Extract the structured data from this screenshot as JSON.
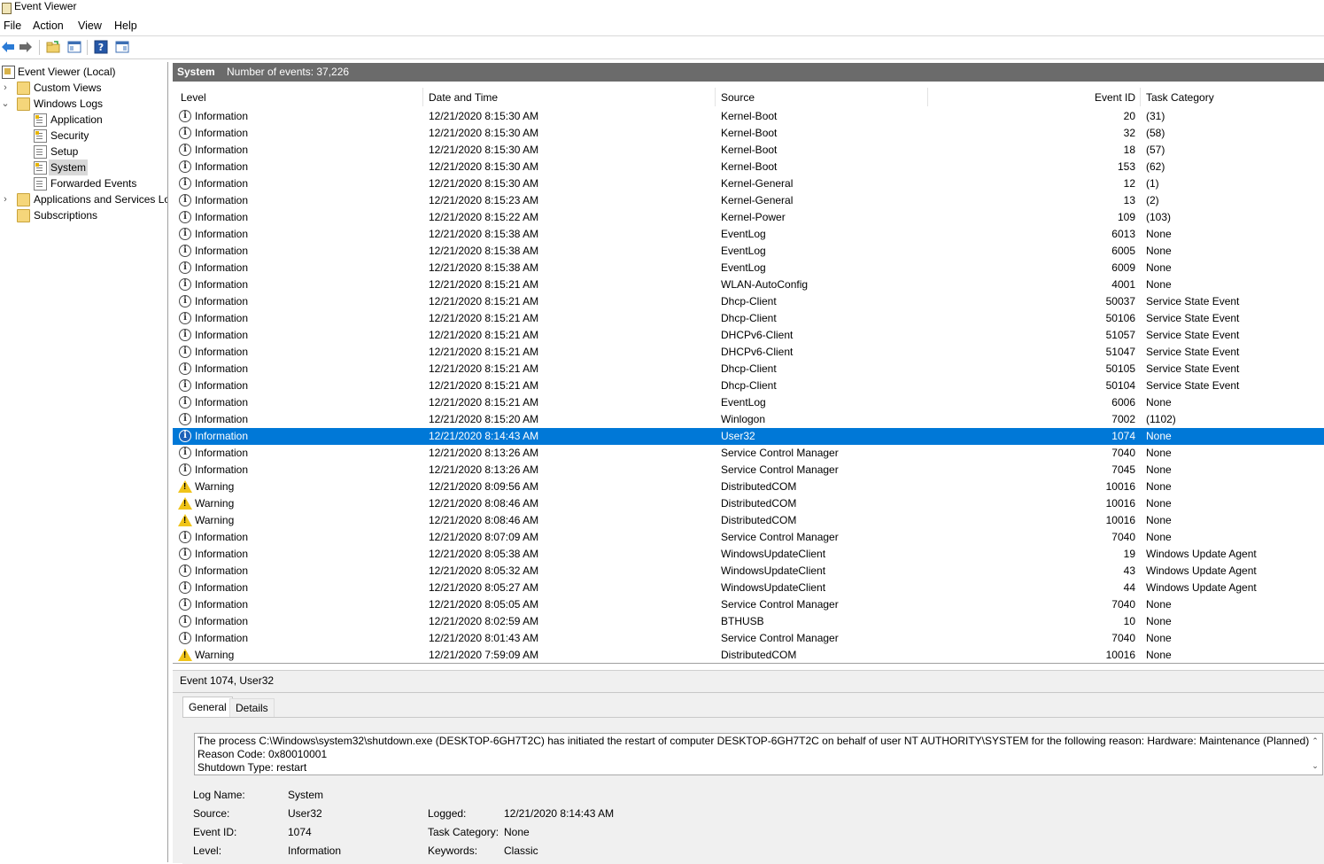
{
  "window": {
    "title": "Event Viewer"
  },
  "menu": [
    "File",
    "Action",
    "View",
    "Help"
  ],
  "toolbar": {
    "icons": [
      "back-arrow-icon",
      "forward-arrow-icon",
      "open-folder-icon",
      "console-tree-icon",
      "help-icon",
      "action-pane-icon"
    ]
  },
  "tree": {
    "root": "Event Viewer (Local)",
    "custom_views": "Custom Views",
    "windows_logs": "Windows Logs",
    "logs": [
      "Application",
      "Security",
      "Setup",
      "System",
      "Forwarded Events"
    ],
    "apps_services": "Applications and Services Lo",
    "subscriptions": "Subscriptions"
  },
  "events_header": {
    "log": "System",
    "count": "Number of events: 37,226"
  },
  "columns": {
    "level": "Level",
    "datetime": "Date and Time",
    "source": "Source",
    "event_id": "Event ID",
    "category": "Task Category"
  },
  "events": [
    {
      "level": "Information",
      "datetime": "12/21/2020 8:15:30 AM",
      "source": "Kernel-Boot",
      "id": "20",
      "category": "(31)"
    },
    {
      "level": "Information",
      "datetime": "12/21/2020 8:15:30 AM",
      "source": "Kernel-Boot",
      "id": "32",
      "category": "(58)"
    },
    {
      "level": "Information",
      "datetime": "12/21/2020 8:15:30 AM",
      "source": "Kernel-Boot",
      "id": "18",
      "category": "(57)"
    },
    {
      "level": "Information",
      "datetime": "12/21/2020 8:15:30 AM",
      "source": "Kernel-Boot",
      "id": "153",
      "category": "(62)"
    },
    {
      "level": "Information",
      "datetime": "12/21/2020 8:15:30 AM",
      "source": "Kernel-General",
      "id": "12",
      "category": "(1)"
    },
    {
      "level": "Information",
      "datetime": "12/21/2020 8:15:23 AM",
      "source": "Kernel-General",
      "id": "13",
      "category": "(2)"
    },
    {
      "level": "Information",
      "datetime": "12/21/2020 8:15:22 AM",
      "source": "Kernel-Power",
      "id": "109",
      "category": "(103)"
    },
    {
      "level": "Information",
      "datetime": "12/21/2020 8:15:38 AM",
      "source": "EventLog",
      "id": "6013",
      "category": "None"
    },
    {
      "level": "Information",
      "datetime": "12/21/2020 8:15:38 AM",
      "source": "EventLog",
      "id": "6005",
      "category": "None"
    },
    {
      "level": "Information",
      "datetime": "12/21/2020 8:15:38 AM",
      "source": "EventLog",
      "id": "6009",
      "category": "None"
    },
    {
      "level": "Information",
      "datetime": "12/21/2020 8:15:21 AM",
      "source": "WLAN-AutoConfig",
      "id": "4001",
      "category": "None"
    },
    {
      "level": "Information",
      "datetime": "12/21/2020 8:15:21 AM",
      "source": "Dhcp-Client",
      "id": "50037",
      "category": "Service State Event"
    },
    {
      "level": "Information",
      "datetime": "12/21/2020 8:15:21 AM",
      "source": "Dhcp-Client",
      "id": "50106",
      "category": "Service State Event"
    },
    {
      "level": "Information",
      "datetime": "12/21/2020 8:15:21 AM",
      "source": "DHCPv6-Client",
      "id": "51057",
      "category": "Service State Event"
    },
    {
      "level": "Information",
      "datetime": "12/21/2020 8:15:21 AM",
      "source": "DHCPv6-Client",
      "id": "51047",
      "category": "Service State Event"
    },
    {
      "level": "Information",
      "datetime": "12/21/2020 8:15:21 AM",
      "source": "Dhcp-Client",
      "id": "50105",
      "category": "Service State Event"
    },
    {
      "level": "Information",
      "datetime": "12/21/2020 8:15:21 AM",
      "source": "Dhcp-Client",
      "id": "50104",
      "category": "Service State Event"
    },
    {
      "level": "Information",
      "datetime": "12/21/2020 8:15:21 AM",
      "source": "EventLog",
      "id": "6006",
      "category": "None"
    },
    {
      "level": "Information",
      "datetime": "12/21/2020 8:15:20 AM",
      "source": "Winlogon",
      "id": "7002",
      "category": "(1102)"
    },
    {
      "level": "Information",
      "datetime": "12/21/2020 8:14:43 AM",
      "source": "User32",
      "id": "1074",
      "category": "None",
      "selected": true
    },
    {
      "level": "Information",
      "datetime": "12/21/2020 8:13:26 AM",
      "source": "Service Control Manager",
      "id": "7040",
      "category": "None"
    },
    {
      "level": "Information",
      "datetime": "12/21/2020 8:13:26 AM",
      "source": "Service Control Manager",
      "id": "7045",
      "category": "None"
    },
    {
      "level": "Warning",
      "datetime": "12/21/2020 8:09:56 AM",
      "source": "DistributedCOM",
      "id": "10016",
      "category": "None"
    },
    {
      "level": "Warning",
      "datetime": "12/21/2020 8:08:46 AM",
      "source": "DistributedCOM",
      "id": "10016",
      "category": "None"
    },
    {
      "level": "Warning",
      "datetime": "12/21/2020 8:08:46 AM",
      "source": "DistributedCOM",
      "id": "10016",
      "category": "None"
    },
    {
      "level": "Information",
      "datetime": "12/21/2020 8:07:09 AM",
      "source": "Service Control Manager",
      "id": "7040",
      "category": "None"
    },
    {
      "level": "Information",
      "datetime": "12/21/2020 8:05:38 AM",
      "source": "WindowsUpdateClient",
      "id": "19",
      "category": "Windows Update Agent"
    },
    {
      "level": "Information",
      "datetime": "12/21/2020 8:05:32 AM",
      "source": "WindowsUpdateClient",
      "id": "43",
      "category": "Windows Update Agent"
    },
    {
      "level": "Information",
      "datetime": "12/21/2020 8:05:27 AM",
      "source": "WindowsUpdateClient",
      "id": "44",
      "category": "Windows Update Agent"
    },
    {
      "level": "Information",
      "datetime": "12/21/2020 8:05:05 AM",
      "source": "Service Control Manager",
      "id": "7040",
      "category": "None"
    },
    {
      "level": "Information",
      "datetime": "12/21/2020 8:02:59 AM",
      "source": "BTHUSB",
      "id": "10",
      "category": "None"
    },
    {
      "level": "Information",
      "datetime": "12/21/2020 8:01:43 AM",
      "source": "Service Control Manager",
      "id": "7040",
      "category": "None"
    },
    {
      "level": "Warning",
      "datetime": "12/21/2020 7:59:09 AM",
      "source": "DistributedCOM",
      "id": "10016",
      "category": "None"
    }
  ],
  "detail": {
    "title": "Event 1074, User32",
    "tabs": [
      "General",
      "Details"
    ],
    "message": [
      "The process C:\\Windows\\system32\\shutdown.exe (DESKTOP-6GH7T2C) has initiated the restart of computer DESKTOP-6GH7T2C on behalf of user NT AUTHORITY\\SYSTEM for the following reason: Hardware: Maintenance (Planned)",
      " Reason Code: 0x80010001",
      " Shutdown Type: restart"
    ],
    "fields": {
      "log_name_label": "Log Name:",
      "log_name": "System",
      "source_label": "Source:",
      "source": "User32",
      "event_id_label": "Event ID:",
      "event_id": "1074",
      "level_label": "Level:",
      "level": "Information",
      "logged_label": "Logged:",
      "logged": "12/21/2020 8:14:43 AM",
      "task_label": "Task Category:",
      "task": "None",
      "keywords_label": "Keywords:",
      "keywords": "Classic"
    }
  },
  "colors": {
    "selection": "#0078d7",
    "header_bar": "#6b6b6b",
    "warning": "#f0c419"
  }
}
